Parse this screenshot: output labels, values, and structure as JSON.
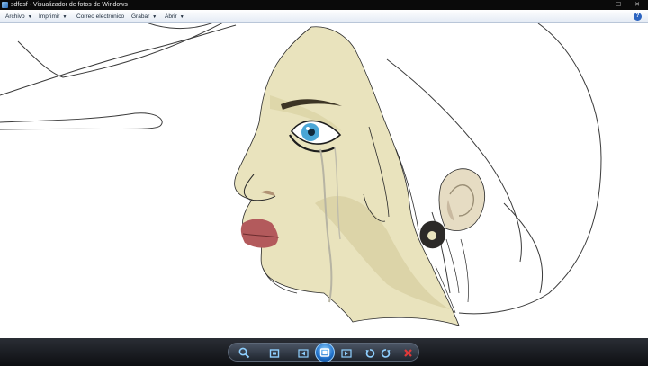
{
  "window": {
    "title": "sdfdsf - Visualizador de fotos de Windows",
    "controls": {
      "minimize": "─",
      "maximize": "☐",
      "close": "✕"
    }
  },
  "menu": {
    "items": [
      {
        "label": "Archivo",
        "has_caret": true
      },
      {
        "label": "Imprimir",
        "has_caret": true
      },
      {
        "label": "Correo electrónico",
        "has_caret": false
      },
      {
        "label": "Grabar",
        "has_caret": true
      },
      {
        "label": "Abrir",
        "has_caret": true
      }
    ],
    "caret": "▼",
    "help": "?"
  },
  "toolbar": {
    "buttons": [
      "zoom-icon",
      "fit-window-icon",
      "previous-icon",
      "slideshow-icon",
      "next-icon",
      "rotate-left-icon",
      "rotate-right-icon",
      "delete-icon"
    ]
  },
  "colors": {
    "titlebar": "#0a0a0a",
    "skin": "#e9e3bd",
    "skin_shadow": "#d8d0a2",
    "lips": "#b35a5c",
    "iris": "#4aa6d6",
    "accent": "#1f6fc8",
    "delete_red": "#e03a3a"
  }
}
